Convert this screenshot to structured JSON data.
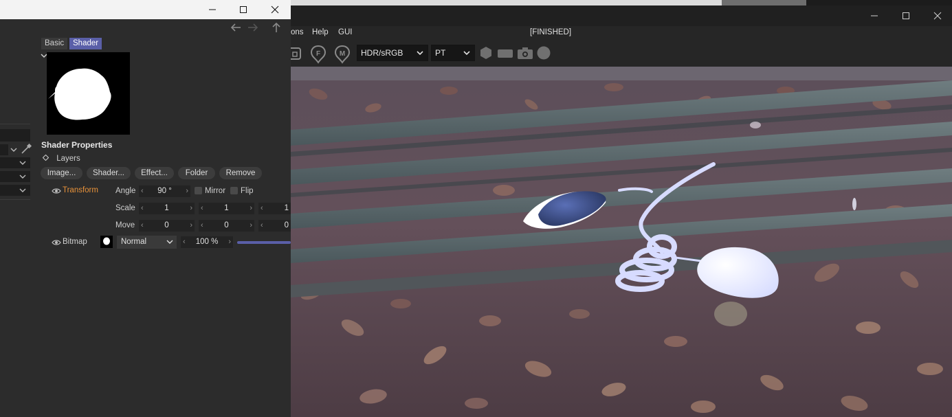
{
  "attribute_panel": {
    "tabs": [
      {
        "label": "Basic"
      },
      {
        "label": "Shader"
      }
    ],
    "section_title": "Shader Properties",
    "layers_label": "Layers",
    "buttons": {
      "image": "Image...",
      "shader": "Shader...",
      "effect": "Effect...",
      "folder": "Folder",
      "remove": "Remove"
    },
    "transform": {
      "label": "Transform",
      "angle_label": "Angle",
      "angle_value": "90 °",
      "mirror_label": "Mirror",
      "flip_label": "Flip",
      "scale_label": "Scale",
      "scale_values": [
        "1",
        "1",
        "1"
      ],
      "move_label": "Move",
      "move_values": [
        "0",
        "0",
        "0"
      ]
    },
    "bitmap": {
      "label": "Bitmap",
      "blend_mode": "Normal",
      "opacity": "100 %"
    },
    "colors": {
      "accent": "#5a5fa8",
      "transform_label": "#e8923a"
    }
  },
  "render_window": {
    "menu": [
      "ons",
      "Help",
      "GUI"
    ],
    "status": "[FINISHED]",
    "toolbar": {
      "color_space": "HDR/sRGB",
      "render_mode": "PT"
    }
  }
}
